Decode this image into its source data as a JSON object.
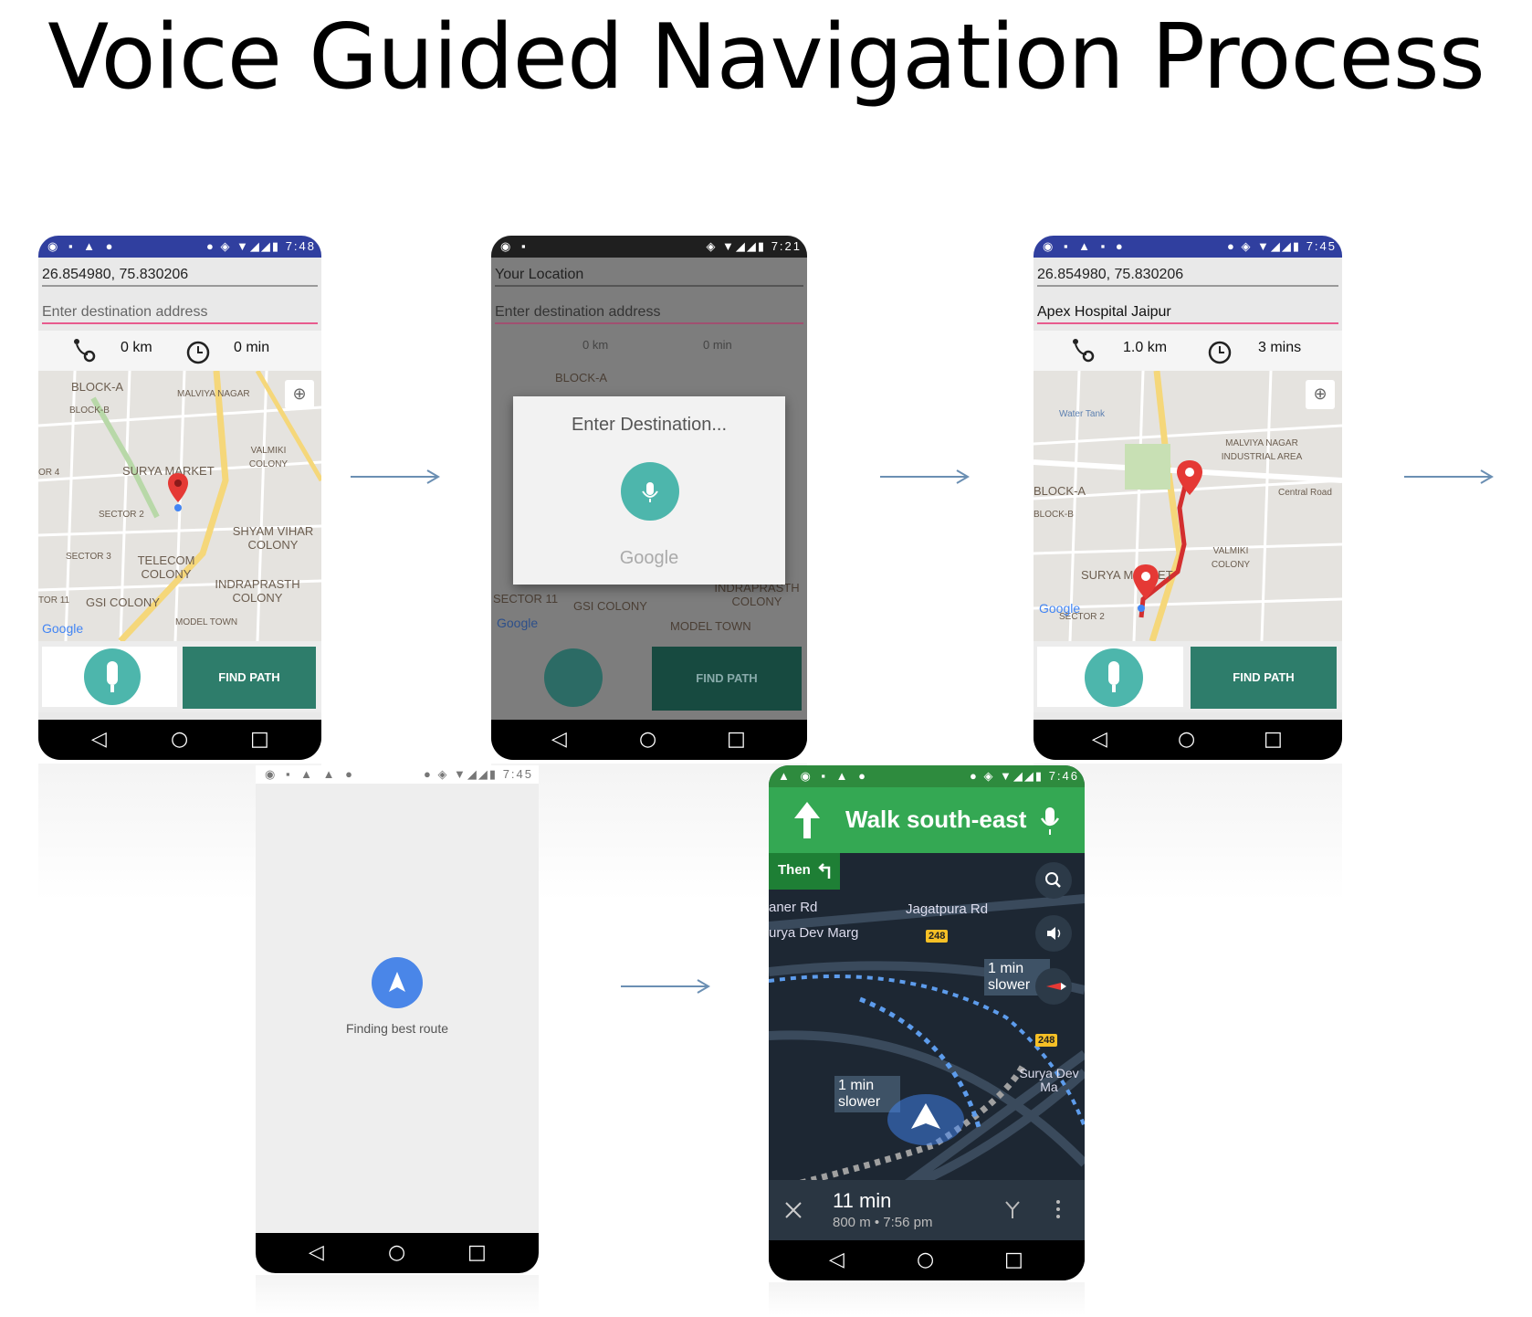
{
  "title": "Voice Guided Navigation Process",
  "status_time": {
    "p1": "7:48",
    "p2": "7:21",
    "p3": "7:45",
    "p4": "7:45",
    "p5": "7:46"
  },
  "screen1": {
    "location": "26.854980, 75.830206",
    "destination_placeholder": "Enter destination address",
    "distance": "0 km",
    "time": "0 min",
    "find_path": "FIND PATH",
    "map_labels": [
      "BLOCK-A",
      "BLOCK-B",
      "MALVIYA NAGAR",
      "VALMIKI COLONY",
      "SURYA MARKET",
      "SECTOR 2",
      "SHYAM VIHAR COLONY",
      "SECTOR 3",
      "TELECOM COLONY",
      "INDRAPRASTH COLONY",
      "GSI COLONY",
      "MODEL TOWN",
      "OR 4",
      "TOR 11"
    ],
    "google": "Google"
  },
  "screen2": {
    "location": "Your Location",
    "destination_placeholder": "Enter destination address",
    "distance": "0 km",
    "time": "0 min",
    "dialog_title": "Enter Destination...",
    "dialog_brand": "Google",
    "find_path": "FIND PATH",
    "map_labels": [
      "BLOCK-A",
      "SECTOR 11",
      "GSI COLONY",
      "INDRAPRASTH COLONY",
      "MODEL TOWN"
    ],
    "google": "Google"
  },
  "screen3": {
    "location": "26.854980, 75.830206",
    "destination": "Apex Hospital Jaipur",
    "distance": "1.0 km",
    "time": "3 mins",
    "find_path": "FIND PATH",
    "map_labels": [
      "Water Tank",
      "MALVIYA NAGAR INDUSTRIAL AREA",
      "BLOCK-A",
      "BLOCK-B",
      "VALMIKI COLONY",
      "SURYA MARKET",
      "Central Road",
      "SECTOR 2"
    ],
    "google": "Google"
  },
  "screen4": {
    "status": "Finding best route"
  },
  "screen5": {
    "instruction": "Walk south-east",
    "then": "Then",
    "roads": [
      "aner Rd",
      "urya Dev Marg",
      "Jagatpura Rd",
      "Surya Dev Ma"
    ],
    "badge": "248",
    "bubble_1": "1 min slower",
    "bubble_2": "1 min slower",
    "eta_minutes": "11 min",
    "eta_detail": "800 m  •  7:56 pm"
  },
  "colors": {
    "status_bar": "#303f9f",
    "accent_teal": "#4db6ac",
    "button_dark": "#2e7d6b",
    "nav_green": "#34a853",
    "route_red": "#d32f2f",
    "arrow": "#6b8fb3"
  }
}
